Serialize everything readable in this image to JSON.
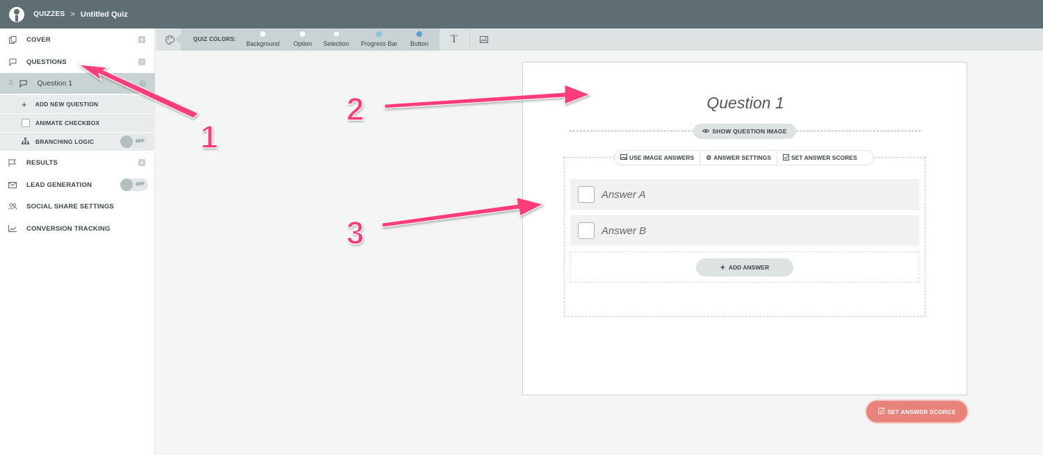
{
  "topbar": {
    "breadcrumb_root": "QUIZZES",
    "breadcrumb_separator": ">",
    "breadcrumb_current": "Untitled Quiz"
  },
  "sidebar": {
    "cover": "COVER",
    "questions": "QUESTIONS",
    "question_1": "Question 1",
    "add_new_question": "ADD NEW QUESTION",
    "animate_checkbox": "ANIMATE CHECKBOX",
    "branching_logic": "BRANCHING LOGIC",
    "branching_toggle": "OFF",
    "results": "RESULTS",
    "lead_generation": "LEAD GENERATION",
    "lead_toggle": "OFF",
    "social_share": "SOCIAL SHARE SETTINGS",
    "conversion_tracking": "CONVERSION TRACKING"
  },
  "toolbar": {
    "quiz_colors_label": "QUIZ COLORS:",
    "swatches": [
      {
        "name": "Background",
        "color": "#ffffff"
      },
      {
        "name": "Option",
        "color": "#ffffff"
      },
      {
        "name": "Selection",
        "color": "#f2f4f4"
      },
      {
        "name": "Progress Bar",
        "color": "#8fc3e6"
      },
      {
        "name": "Button",
        "color": "#5a9fd6"
      }
    ]
  },
  "question": {
    "title": "Question 1",
    "show_image": "SHOW QUESTION IMAGE",
    "use_image_answers": "USE IMAGE ANSWERS",
    "answer_settings": "ANSWER SETTINGS",
    "set_answer_scores": "SET ANSWER SCORES",
    "answers": [
      "Answer A",
      "Answer B"
    ],
    "add_answer": "ADD ANSWER"
  },
  "footer": {
    "set_answer_scores": "SET ANSWER SCORES"
  },
  "annotations": {
    "labels": [
      "1",
      "2",
      "3"
    ],
    "color": "#ff3c78"
  }
}
